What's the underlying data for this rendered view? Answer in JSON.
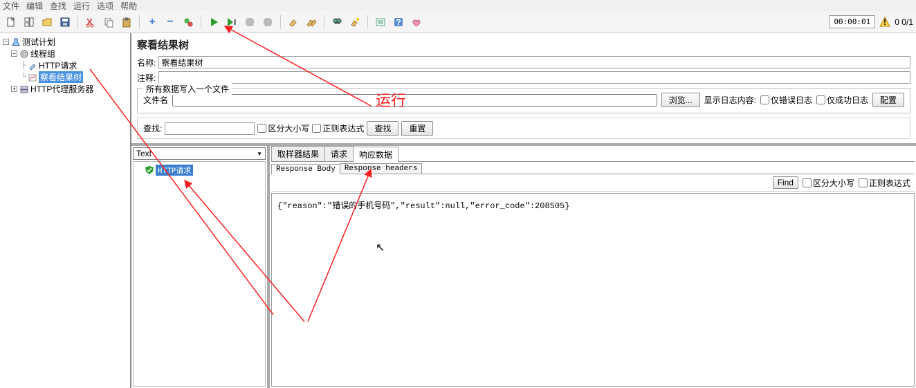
{
  "menubar": {
    "items": [
      "文件",
      "编辑",
      "查找",
      "运行",
      "选项",
      "帮助"
    ]
  },
  "toolbar": {
    "timer": "00:00:01",
    "errcount": "0  0/1"
  },
  "tree": {
    "root": "测试计划",
    "thread_group": "线程组",
    "http_request": "HTTP请求",
    "view_results": "察看结果树",
    "proxy": "HTTP代理服务器"
  },
  "panel": {
    "title": "察看结果树",
    "name_label": "名称:",
    "name_value": "察看结果树",
    "comment_label": "注释:",
    "comment_value": "",
    "fileset_legend": "所有数据写入一个文件",
    "filename_label": "文件名",
    "filename_value": "",
    "browse_btn": "浏览...",
    "loglabel": "显示日志内容:",
    "err_only": "仅错误日志",
    "ok_only": "仅成功日志",
    "configure": "配置",
    "search_label": "查找:",
    "case_sensitive": "区分大小写",
    "regex": "正则表达式",
    "search_btn": "查找",
    "reset_btn": "重置"
  },
  "results": {
    "dropdown": "Text",
    "item_label": "HTTP请求"
  },
  "tabs": {
    "sampler": "取样器结果",
    "request": "请求",
    "response": "响应数据",
    "body_tab": "Response Body",
    "headers_tab": "Response headers"
  },
  "find": {
    "btn": "Find",
    "case_sensitive": "区分大小写",
    "regex": "正则表达式"
  },
  "response_body": "{\"reason\":\"错误的手机号码\",\"result\":null,\"error_code\":208505}",
  "annotation": "运行"
}
